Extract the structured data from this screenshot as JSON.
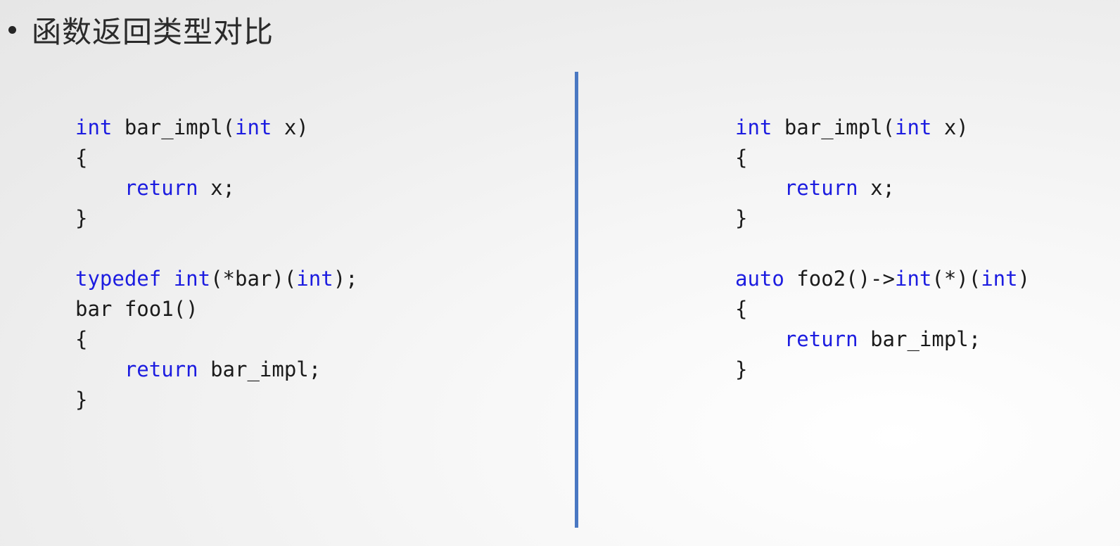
{
  "slide": {
    "title": "函数返回类型对比"
  },
  "colors": {
    "keyword": "#1c1ce0",
    "text": "#1a1a1a",
    "divider": "#4a78c2"
  },
  "left_code": [
    [
      {
        "t": "int",
        "k": true
      },
      {
        "t": " bar_impl(",
        "k": false
      },
      {
        "t": "int",
        "k": true
      },
      {
        "t": " x)",
        "k": false
      }
    ],
    [
      {
        "t": "{",
        "k": false
      }
    ],
    [
      {
        "t": "    ",
        "k": false
      },
      {
        "t": "return",
        "k": true
      },
      {
        "t": " x;",
        "k": false
      }
    ],
    [
      {
        "t": "}",
        "k": false
      }
    ],
    [],
    [
      {
        "t": "typedef",
        "k": true
      },
      {
        "t": " ",
        "k": false
      },
      {
        "t": "int",
        "k": true
      },
      {
        "t": "(*bar)(",
        "k": false
      },
      {
        "t": "int",
        "k": true
      },
      {
        "t": ");",
        "k": false
      }
    ],
    [
      {
        "t": "bar foo1()",
        "k": false
      }
    ],
    [
      {
        "t": "{",
        "k": false
      }
    ],
    [
      {
        "t": "    ",
        "k": false
      },
      {
        "t": "return",
        "k": true
      },
      {
        "t": " bar_impl;",
        "k": false
      }
    ],
    [
      {
        "t": "}",
        "k": false
      }
    ]
  ],
  "right_code": [
    [
      {
        "t": "int",
        "k": true
      },
      {
        "t": " bar_impl(",
        "k": false
      },
      {
        "t": "int",
        "k": true
      },
      {
        "t": " x)",
        "k": false
      }
    ],
    [
      {
        "t": "{",
        "k": false
      }
    ],
    [
      {
        "t": "    ",
        "k": false
      },
      {
        "t": "return",
        "k": true
      },
      {
        "t": " x;",
        "k": false
      }
    ],
    [
      {
        "t": "}",
        "k": false
      }
    ],
    [],
    [
      {
        "t": "auto",
        "k": true
      },
      {
        "t": " foo2()->",
        "k": false
      },
      {
        "t": "int",
        "k": true
      },
      {
        "t": "(*)(",
        "k": false
      },
      {
        "t": "int",
        "k": true
      },
      {
        "t": ")",
        "k": false
      }
    ],
    [
      {
        "t": "{",
        "k": false
      }
    ],
    [
      {
        "t": "    ",
        "k": false
      },
      {
        "t": "return",
        "k": true
      },
      {
        "t": " bar_impl;",
        "k": false
      }
    ],
    [
      {
        "t": "}",
        "k": false
      }
    ]
  ]
}
